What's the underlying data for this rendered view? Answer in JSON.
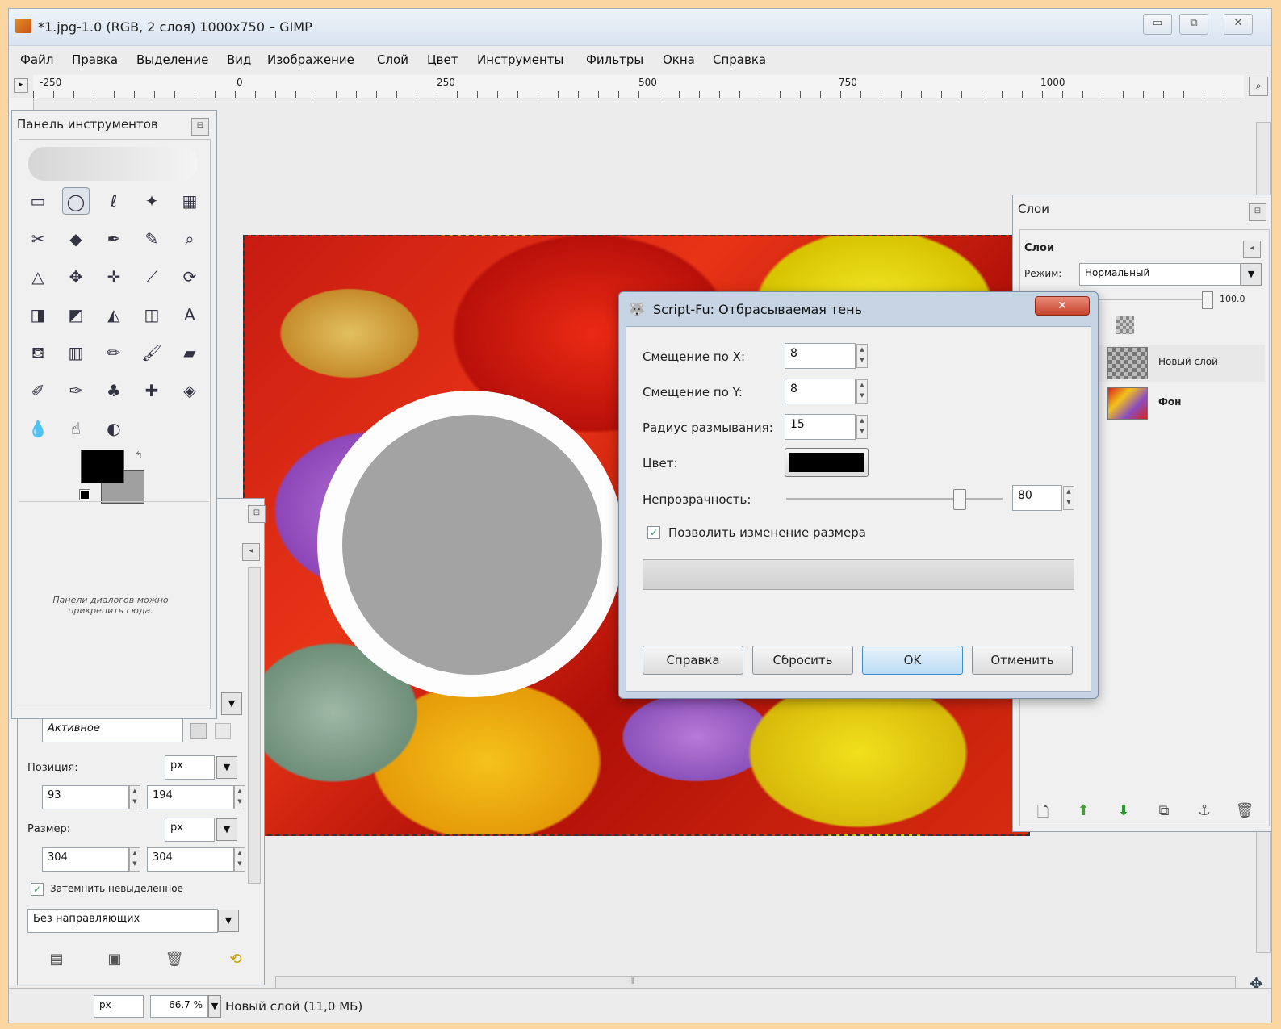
{
  "window": {
    "title": "*1.jpg-1.0 (RGB, 2 слоя) 1000x750 – GIMP",
    "controls": [
      "▭",
      "⧉",
      "✕"
    ]
  },
  "menu": [
    "Файл",
    "Правка",
    "Выделение",
    "Вид",
    "Изображение",
    "Слой",
    "Цвет",
    "Инструменты",
    "Фильтры",
    "Окна",
    "Справка"
  ],
  "ruler": {
    "labels": [
      "-250",
      "0",
      "250",
      "500",
      "750",
      "1000"
    ]
  },
  "toolbox": {
    "title": "Панель инструментов",
    "hint": "Панели диалогов можно прикрепить сюда.",
    "tools": [
      {
        "name": "rect-select-icon",
        "glyph": "▭"
      },
      {
        "name": "ellipse-select-icon",
        "glyph": "◯"
      },
      {
        "name": "free-select-icon",
        "glyph": "ℓ"
      },
      {
        "name": "fuzzy-select-icon",
        "glyph": "✦"
      },
      {
        "name": "color-select-icon",
        "glyph": "▦"
      },
      {
        "name": "scissors-icon",
        "glyph": "✂"
      },
      {
        "name": "foreground-select-icon",
        "glyph": "◆"
      },
      {
        "name": "paths-icon",
        "glyph": "✒"
      },
      {
        "name": "color-picker-icon",
        "glyph": "✎"
      },
      {
        "name": "zoom-icon",
        "glyph": "⌕"
      },
      {
        "name": "measure-icon",
        "glyph": "△"
      },
      {
        "name": "move-icon",
        "glyph": "✥"
      },
      {
        "name": "align-icon",
        "glyph": "✛"
      },
      {
        "name": "crop-icon",
        "glyph": "⟋"
      },
      {
        "name": "rotate-icon",
        "glyph": "⟳"
      },
      {
        "name": "scale-icon",
        "glyph": "◨"
      },
      {
        "name": "shear-icon",
        "glyph": "◩"
      },
      {
        "name": "perspective-icon",
        "glyph": "◭"
      },
      {
        "name": "flip-icon",
        "glyph": "◫"
      },
      {
        "name": "text-icon",
        "glyph": "A"
      },
      {
        "name": "bucket-fill-icon",
        "glyph": "⛾"
      },
      {
        "name": "blend-icon",
        "glyph": "▥"
      },
      {
        "name": "pencil-icon",
        "glyph": "✏"
      },
      {
        "name": "paintbrush-icon",
        "glyph": "🖌"
      },
      {
        "name": "eraser-icon",
        "glyph": "▰"
      },
      {
        "name": "airbrush-icon",
        "glyph": "✐"
      },
      {
        "name": "ink-icon",
        "glyph": "✑"
      },
      {
        "name": "clone-icon",
        "glyph": "♣"
      },
      {
        "name": "heal-icon",
        "glyph": "✚"
      },
      {
        "name": "perspective-clone-icon",
        "glyph": "◈"
      },
      {
        "name": "blur-icon",
        "glyph": "💧"
      },
      {
        "name": "smudge-icon",
        "glyph": "☝"
      },
      {
        "name": "dodge-burn-icon",
        "glyph": "◐"
      }
    ],
    "fg_color": "#000000",
    "bg_color": "#a0a0a0"
  },
  "tool_options": {
    "mode_value": "Активное",
    "position_label": "Позиция:",
    "position_unit": "px",
    "position_x": "93",
    "position_y": "194",
    "size_label": "Размер:",
    "size_unit": "px",
    "size_w": "304",
    "size_h": "304",
    "checkbox_label": "Затемнить невыделенное",
    "guides_value": "Без направляющих"
  },
  "layers": {
    "title": "Слои",
    "tab_label": "Слои",
    "mode_label": "Режим:",
    "mode_value": "Нормальный",
    "opacity_value": "100.0",
    "items": [
      {
        "name": "Новый слой"
      },
      {
        "name": "Фон"
      }
    ]
  },
  "dialog": {
    "title": "Script-Fu: Отбрасываемая тень",
    "offset_x_label": "Смещение по X:",
    "offset_x_value": "8",
    "offset_y_label": "Смещение по Y:",
    "offset_y_value": "8",
    "blur_label": "Радиус размывания:",
    "blur_value": "15",
    "color_label": "Цвет:",
    "color_value": "#000000",
    "opacity_label": "Непрозрачность:",
    "opacity_value": "80",
    "opacity_fraction": 0.8,
    "resize_label": "Позволить изменение размера",
    "resize_checked": true,
    "buttons": {
      "help": "Справка",
      "reset": "Сбросить",
      "ok": "OK",
      "cancel": "Отменить"
    }
  },
  "status": {
    "unit": "px",
    "zoom": "66.7 %",
    "message": "Новый слой (11,0 МБ)"
  }
}
